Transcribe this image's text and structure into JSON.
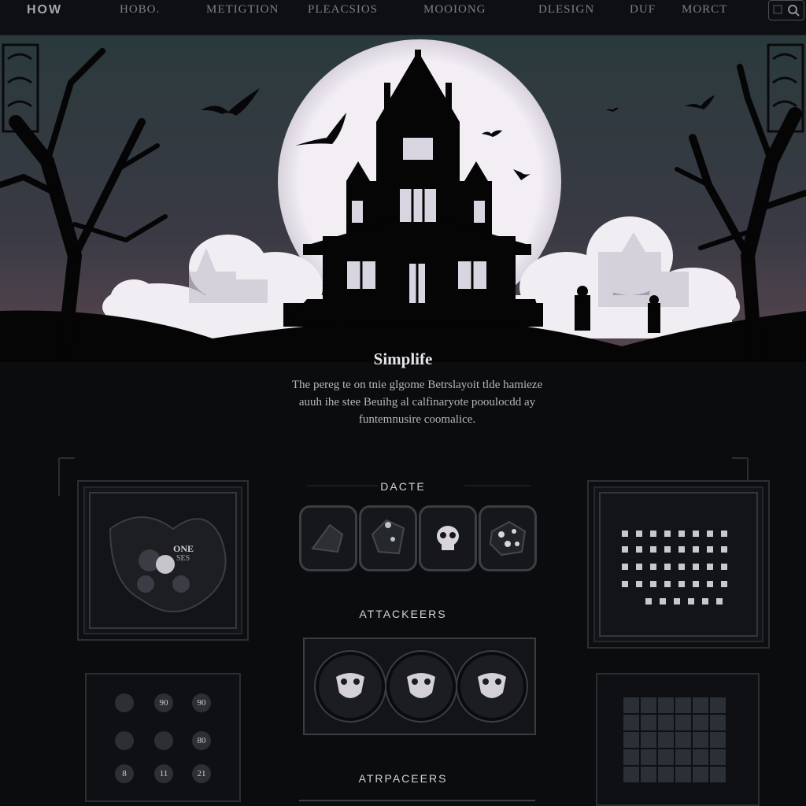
{
  "nav": {
    "brand": "HOW",
    "items": [
      "HOBO.",
      "METIGTION",
      "PLEACSIOS",
      "MOOIONG",
      "DLESIGN",
      "DUF",
      "MORCT"
    ]
  },
  "hero": {
    "title": "Simplife",
    "description_lines": [
      "The pereg te on tnie glgome Betrslayoit tlde hamieze",
      "auuh ihe stee Beuihg al calfinaryote pooulocdd ay",
      "funtemnusire coomalice."
    ]
  },
  "sections": {
    "dice_title": "DACTE",
    "attackers_title": "ATTACKEERS",
    "bottom_title": "ATRPACEERS"
  },
  "left_card": {
    "label_top": "ONE",
    "label_bottom": "SES"
  },
  "stats": {
    "rows": [
      [
        "",
        "90",
        "90"
      ],
      [
        "",
        "",
        "80"
      ],
      [
        "8",
        "11",
        "21"
      ]
    ]
  },
  "colors": {
    "sky_top": "#2a3a3c",
    "sky_bottom": "#5a4650",
    "moon": "#f2eef4",
    "silhouette": "#050506",
    "background": "#0b0c0e"
  }
}
